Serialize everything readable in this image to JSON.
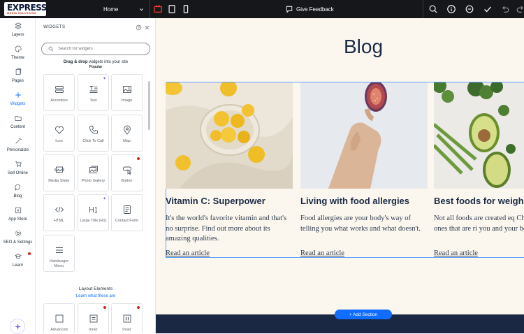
{
  "topbar": {
    "logo_main": "EXPRESS",
    "logo_sub": "MEDIA SOLUTIONS",
    "page_select": "Home",
    "feedback_label": "Give Feedback"
  },
  "leftnav": {
    "items": [
      {
        "label": "Layers",
        "icon": "layers-icon"
      },
      {
        "label": "Theme",
        "icon": "palette-icon"
      },
      {
        "label": "Pages",
        "icon": "pages-icon"
      },
      {
        "label": "Widgets",
        "icon": "plus-icon",
        "active": true
      },
      {
        "label": "Content",
        "icon": "folder-icon"
      },
      {
        "label": "Personalize",
        "icon": "magic-wand-icon"
      },
      {
        "label": "Sell Online",
        "icon": "cart-icon"
      },
      {
        "label": "Blog",
        "icon": "chat-bubble-icon"
      },
      {
        "label": "App Store",
        "icon": "store-icon"
      },
      {
        "label": "SEO & Settings",
        "icon": "gear-icon"
      },
      {
        "label": "Learn",
        "icon": "graduation-cap-icon"
      }
    ]
  },
  "panel": {
    "title": "WIDGETS",
    "search_placeholder": "Search for widgets",
    "drag_hint_bold": "Drag & drop",
    "drag_hint_rest": " widgets into your site",
    "popular_label": "Popular",
    "tiles": [
      {
        "label": "Accordion",
        "icon": "accordion-icon"
      },
      {
        "label": "Text",
        "icon": "text-icon"
      },
      {
        "label": "Image",
        "icon": "image-icon"
      },
      {
        "label": "Icon",
        "icon": "heart-icon"
      },
      {
        "label": "Click To Call",
        "icon": "phone-icon"
      },
      {
        "label": "Map",
        "icon": "map-pin-icon"
      },
      {
        "label": "Media Slider",
        "icon": "media-slider-icon"
      },
      {
        "label": "Photo Gallery",
        "icon": "photo-gallery-icon"
      },
      {
        "label": "Button",
        "icon": "button-cursor-icon"
      },
      {
        "label": "HTML",
        "icon": "code-icon"
      },
      {
        "label": "Large Title (H1)",
        "icon": "heading-icon"
      },
      {
        "label": "Contact Form",
        "icon": "form-icon"
      },
      {
        "label": "Hamburger Menu",
        "icon": "hamburger-icon"
      }
    ],
    "layout_title": "Layout Elements",
    "layout_link": "Learn what these are",
    "layout_tiles": [
      {
        "label": "Advanced",
        "icon": "square-icon"
      },
      {
        "label": "Inner",
        "icon": "inner-section-icon"
      },
      {
        "label": "Inner",
        "icon": "inner-columns-icon"
      }
    ]
  },
  "canvas": {
    "blog_title": "Blog",
    "cards": [
      {
        "title": "Vitamin C: Superpower",
        "text": "It's the world's favorite vitamin and that's no surprise. Find out more about its amazing qualities.",
        "link": "Read an article",
        "image": "lemons-bowl-image"
      },
      {
        "title": "Living with food allergies",
        "text": "Food allergies are your body's way of telling you what works and what doesn't.",
        "link": "Read an article",
        "image": "hand-holding-fig-image"
      },
      {
        "title": "Best foods for weigh",
        "text": "Not all foods are created eq Choose the ones that are ri you and your body.",
        "link": "Read an article",
        "image": "vegetables-avocado-image"
      }
    ],
    "add_section_label": "+ Add Section"
  },
  "colors": {
    "topbar_bg": "#16171a",
    "accent": "#116dff",
    "canvas_bg": "#fbf7ef",
    "navy": "#1b2843",
    "red_accent": "#e62214"
  }
}
